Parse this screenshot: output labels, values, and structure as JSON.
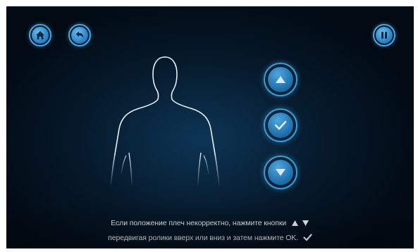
{
  "colors": {
    "accent": "#4aa6e0",
    "background": "#06192b",
    "outline": "#e8f1f8",
    "text": "#e6eef5"
  },
  "top_bar": {
    "home_button": {
      "icon": "home-icon"
    },
    "back_button": {
      "icon": "undo-arrow-icon"
    },
    "pause_button": {
      "icon": "pause-icon"
    }
  },
  "figure": {
    "icon": "body-silhouette-icon"
  },
  "controls": {
    "up_button": {
      "icon": "triangle-up-icon"
    },
    "ok_button": {
      "icon": "checkmark-icon"
    },
    "down_button": {
      "icon": "triangle-down-icon"
    }
  },
  "instructions": {
    "line1": "Если положение плеч некорректно, нажмите кнопки",
    "line2": "передвигая ролики вверх или вниз и затем нажмите OK.",
    "line1_icons": [
      "triangle-up-icon",
      "triangle-down-icon"
    ],
    "line2_icon": "checkmark-icon"
  }
}
